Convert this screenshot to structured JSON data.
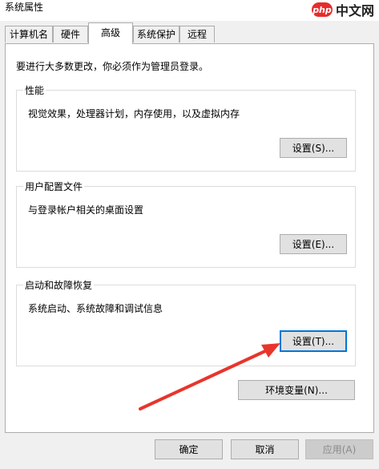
{
  "window": {
    "title": "系统属性"
  },
  "watermark": {
    "logo": "php",
    "text": "中文网"
  },
  "tabs": [
    {
      "label": "计算机名",
      "active": false
    },
    {
      "label": "硬件",
      "active": false
    },
    {
      "label": "高级",
      "active": true
    },
    {
      "label": "系统保护",
      "active": false
    },
    {
      "label": "远程",
      "active": false
    }
  ],
  "notice": "要进行大多数更改，你必须作为管理员登录。",
  "groups": {
    "performance": {
      "title": "性能",
      "description": "视觉效果，处理器计划，内存使用，以及虚拟内存",
      "button": "设置(S)..."
    },
    "user_profiles": {
      "title": "用户配置文件",
      "description": "与登录帐户相关的桌面设置",
      "button": "设置(E)..."
    },
    "startup_recovery": {
      "title": "启动和故障恢复",
      "description": "系统启动、系统故障和调试信息",
      "button": "设置(T)..."
    }
  },
  "env_button": "环境变量(N)...",
  "footer": {
    "ok": "确定",
    "cancel": "取消",
    "apply": "应用(A)"
  },
  "annotation": {
    "arrow_color": "#e8352c"
  },
  "colors": {
    "focus_border": "#0078d7",
    "watermark_red": "#e52d2d"
  }
}
